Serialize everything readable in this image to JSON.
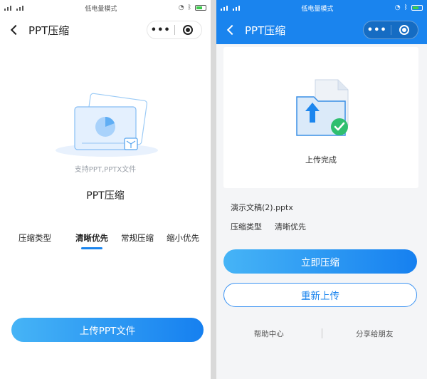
{
  "status_bar": {
    "carrier_left": "4G 5G",
    "mode": "低电量模式",
    "colors": {
      "left_bg": "#ffffff",
      "right_bg": "#1a84ee",
      "battery": "#3ccb4c"
    }
  },
  "left_screen": {
    "nav_title": "PPT压缩",
    "capsule": {
      "more": "•••"
    },
    "hint": "支持PPT,PPTX文件",
    "title": "PPT压缩",
    "type_label": "压缩类型",
    "options": [
      "清晰优先",
      "常规压缩",
      "缩小优先"
    ],
    "selected_option": "清晰优先",
    "upload_button": "上传PPT文件"
  },
  "right_screen": {
    "nav_title": "PPT压缩",
    "capsule": {
      "more": "•••"
    },
    "card_status": "上传完成",
    "file_name": "演示文稿(2).pptx",
    "type_label": "压缩类型",
    "type_value": "清晰优先",
    "compress_button": "立即压缩",
    "reupload_button": "重新上传",
    "footer": {
      "help": "帮助中心",
      "share": "分享给朋友"
    }
  },
  "icons": [
    "back-arrow-icon",
    "more-icon",
    "close-target-icon",
    "file-illustration-icon",
    "upload-complete-icon",
    "check-icon",
    "battery-icon",
    "signal-icon"
  ],
  "accent_color": "#1a84ee"
}
